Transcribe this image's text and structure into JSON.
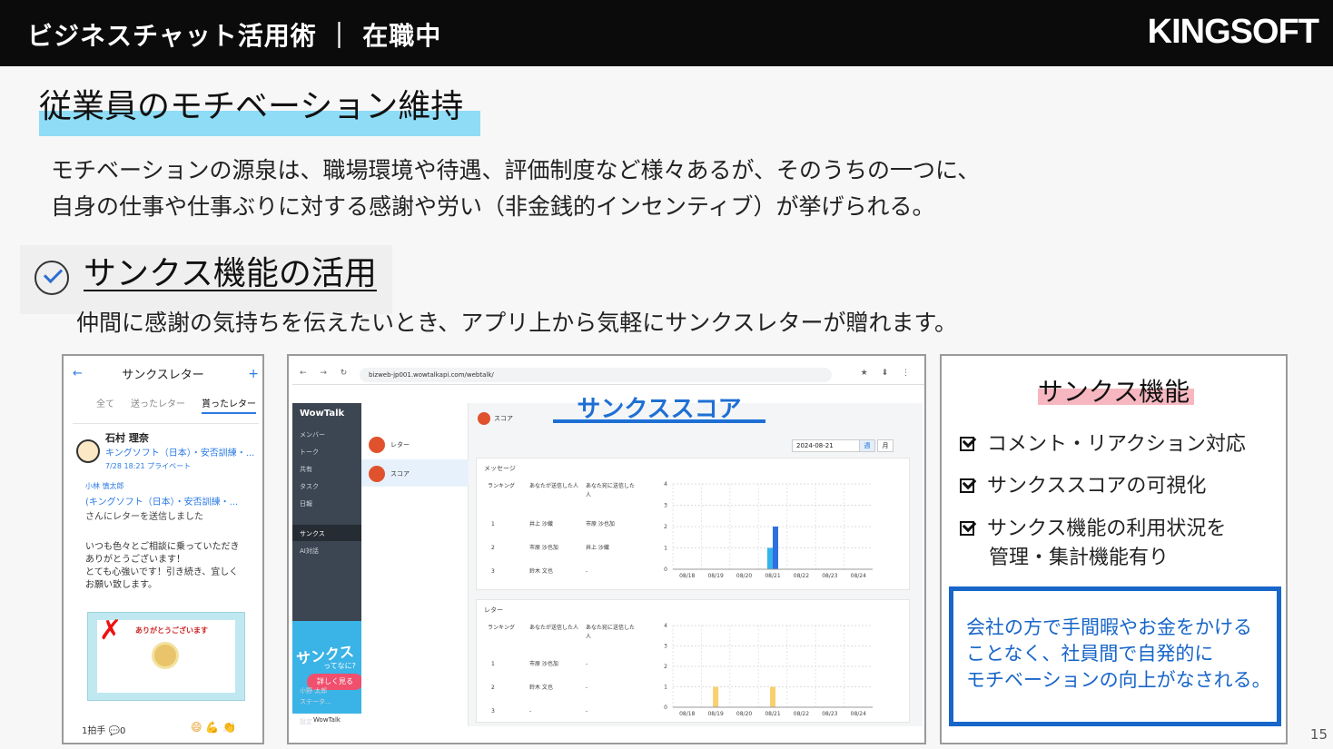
{
  "header": {
    "title": "ビジネスチャット活用術 ｜ 在職中",
    "logo": "KINGSOFT"
  },
  "heading1": "従業員のモチベーション維持",
  "intro": [
    "モチベーションの源泉は、職場環境や待遇、評価制度など様々あるが、そのうちの一つに、",
    "自身の仕事や仕事ぶりに対する感謝や労い（非金銭的インセンティブ）が挙げられる。"
  ],
  "heading2": "サンクス機能の活用",
  "subtitle": "仲間に感謝の気持ちを伝えたいとき、アプリ上から気軽にサンクスレターが贈れます。",
  "phone": {
    "title": "サンクスレター",
    "tabs": [
      "全て",
      "送ったレター",
      "貰ったレター"
    ],
    "sender": "石村 理奈",
    "org": "キングソフト（日本）・安否訓練・...",
    "date": "7/28 18:21 プライベート",
    "to_name": "小林 慎太郎",
    "to_org": "(キングソフト（日本）・安否訓練・...",
    "to_line": "さんにレターを送信しました",
    "message": [
      "いつも色々とご相談に乗っていただき",
      "ありがとうございます！",
      "とても心強いです！引き続き、宜しく",
      "お願い致します。"
    ],
    "card_text": "ありがとうございます",
    "footer": "1拍手 💬0"
  },
  "app": {
    "url": "bizweb-jp001.wowtalkapi.com/webtalk/",
    "brand": "WowTalk",
    "menu": [
      "メンバー",
      "トーク",
      "共有",
      "タスク",
      "日報",
      "サンクス",
      "AI対話"
    ],
    "ad_title": "サンクス",
    "ad_sub": "ってなに?",
    "ad_button": "詳しく見る",
    "ad_footer": "WowTalk",
    "user": "小野 太郎",
    "user_status": "ステータ...",
    "settings": "設定",
    "list": [
      "レター",
      "スコア"
    ],
    "header": "スコア",
    "overlay_title": "サンクススコア",
    "date": "2024-08-21",
    "seg": [
      "週",
      "月"
    ],
    "msg_section": "メッセージ",
    "letter_section": "レター",
    "cols": [
      "ランキング",
      "あなたが送信した人",
      "あなた宛に送信した人"
    ],
    "msg_rows": [
      [
        "1",
        "井上 沙織",
        "市原 沙也加"
      ],
      [
        "2",
        "市原 沙也加",
        "井上 沙織"
      ],
      [
        "3",
        "鈴木 文也",
        "-"
      ]
    ],
    "letter_rows": [
      [
        "1",
        "市原 沙也加",
        "-"
      ],
      [
        "2",
        "鈴木 文也",
        "-"
      ],
      [
        "3",
        "-",
        "-"
      ]
    ]
  },
  "chart_data": [
    {
      "type": "bar",
      "categories": [
        "08/18",
        "08/19",
        "08/20",
        "08/21",
        "08/22",
        "08/23",
        "08/24"
      ],
      "series": [
        {
          "values": [
            0,
            0,
            0,
            1,
            0,
            0,
            0
          ]
        },
        {
          "values": [
            0,
            0,
            0,
            2,
            0,
            0,
            0
          ]
        }
      ],
      "ylim": [
        0,
        4
      ]
    },
    {
      "type": "bar",
      "categories": [
        "08/18",
        "08/19",
        "08/20",
        "08/21",
        "08/22",
        "08/23",
        "08/24"
      ],
      "series": [
        {
          "values": [
            0,
            1,
            0,
            1,
            0,
            0,
            0
          ]
        }
      ],
      "ylim": [
        0,
        4
      ]
    }
  ],
  "features": {
    "title": "サンクス機能",
    "items": [
      "コメント・リアクション対応",
      "サンクススコアの可視化",
      "サンクス機能の利用状況を",
      "管理・集計機能有り"
    ],
    "note": [
      "会社の方で手間暇やお金をかける",
      "ことなく、社員間で自発的に",
      "モチベーションの向上がなされる。"
    ]
  },
  "page_number": "15",
  "colors": {
    "accent": "#1e6fd4",
    "highlight": "#8fdcf7",
    "pink": "#f6b7c0",
    "bar1": "#36b3ea",
    "bar2": "#2f6fe0",
    "bar3": "#f7d070"
  }
}
